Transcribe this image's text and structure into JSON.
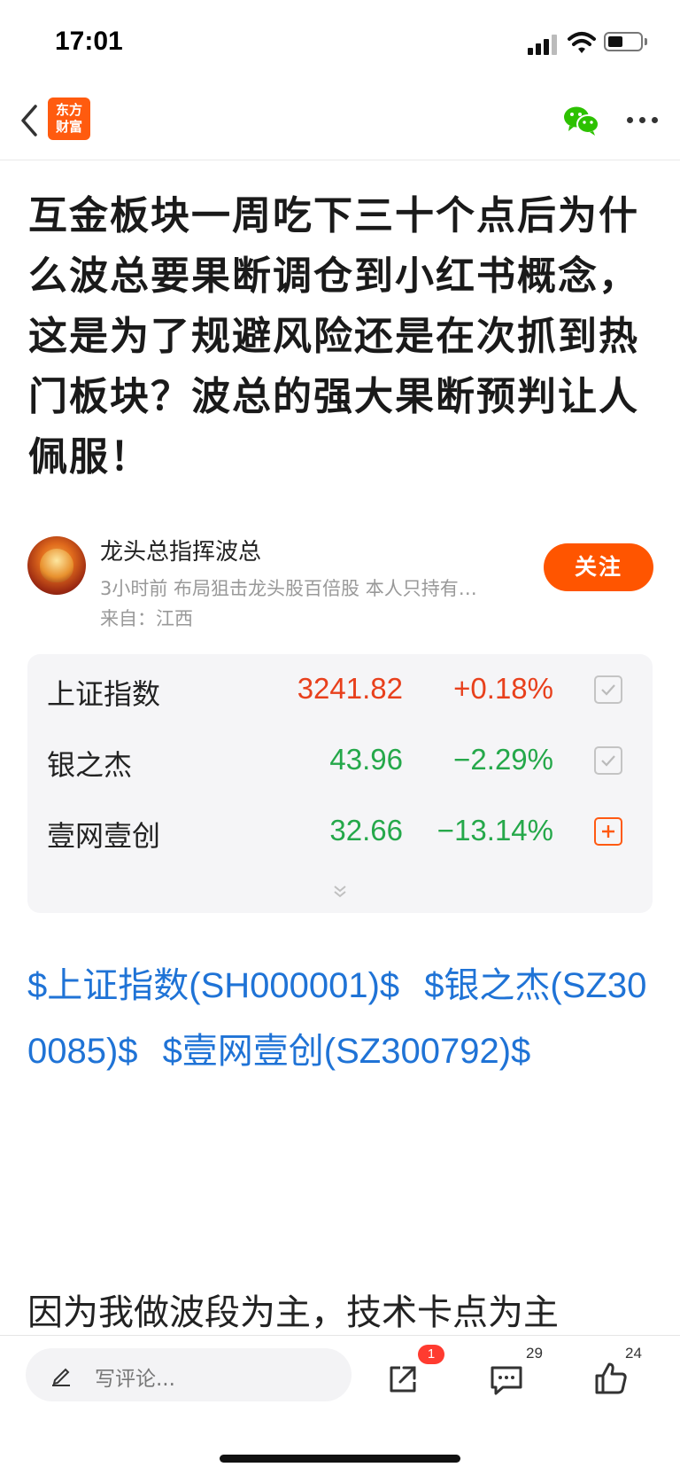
{
  "status": {
    "time": "17:01",
    "battery_level": 0.45
  },
  "nav": {
    "logo_line1": "东方",
    "logo_line2": "财富"
  },
  "article": {
    "title": "互金板块一周吃下三十个点后为什么波总要果断调仓到小红书概念，这是为了规避风险还是在次抓到热门板块？波总的强大果断预判让人佩服！",
    "body_start": "因为我做波段为主，技术卡点为主"
  },
  "author": {
    "name": "龙头总指挥波总",
    "meta": "3小时前  布局狙击龙头股百倍股  本人只持有…",
    "location": "来自：江西",
    "follow_label": "关注"
  },
  "stocks": [
    {
      "name": "上证指数",
      "price": "3241.82",
      "change": "+0.18%",
      "direction": "up",
      "in_watchlist": true
    },
    {
      "name": "银之杰",
      "price": "43.96",
      "change": "−2.29%",
      "direction": "down",
      "in_watchlist": true
    },
    {
      "name": "壹网壹创",
      "price": "32.66",
      "change": "−13.14%",
      "direction": "down",
      "in_watchlist": false
    }
  ],
  "tags": [
    "$上证指数(SH000001)$",
    "$银之杰(SZ300085)$",
    "$壹网壹创(SZ300792)$"
  ],
  "bottom": {
    "comment_placeholder": "写评论...",
    "share_badge": "1",
    "comment_count": "29",
    "like_count": "24"
  },
  "colors": {
    "accent": "#ff5500",
    "up": "#e8401c",
    "down": "#25a84a",
    "link": "#1f73d6"
  }
}
